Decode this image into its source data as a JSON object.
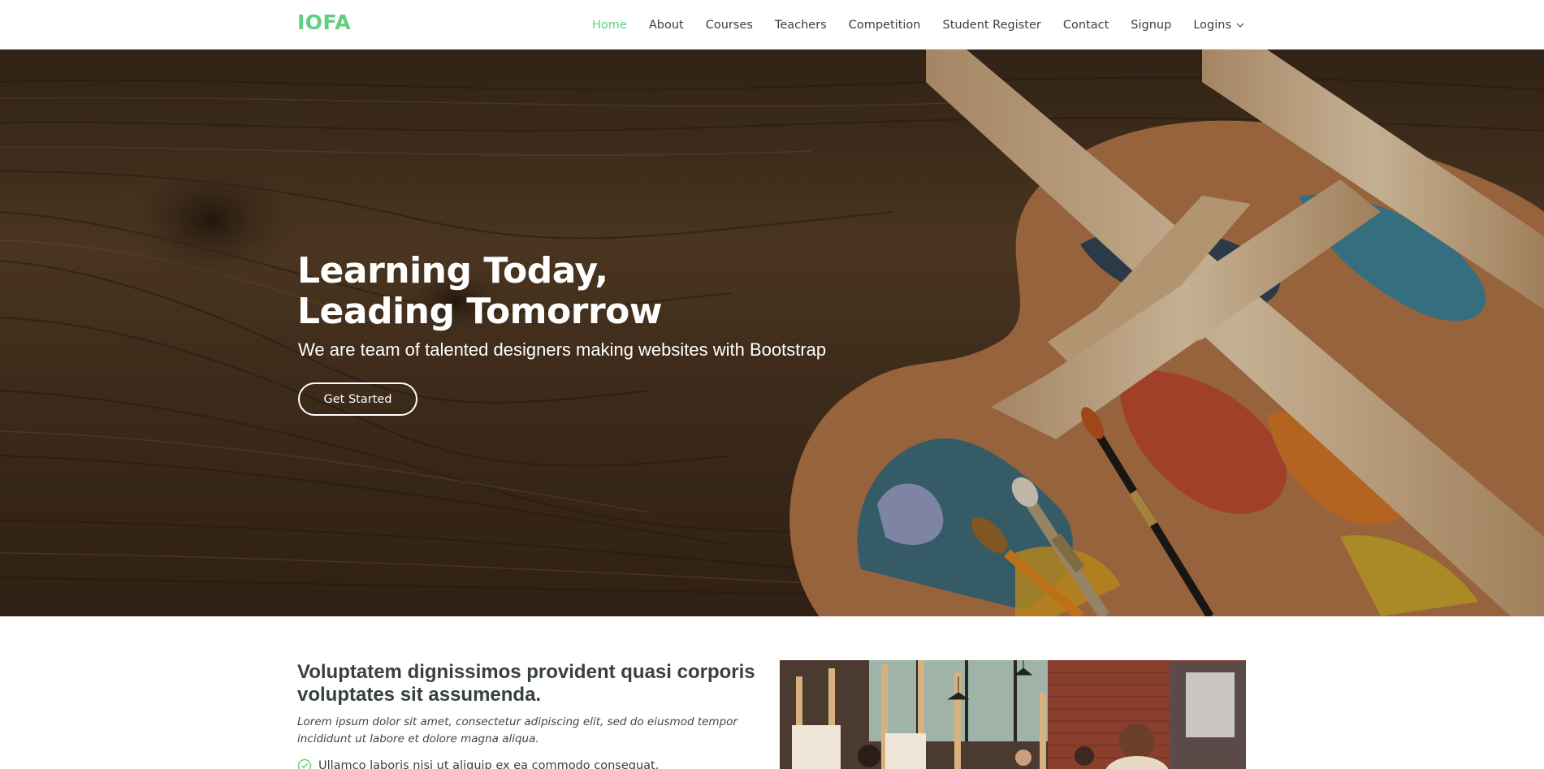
{
  "brand": {
    "logo": "IOFA",
    "accent": "#5fcf80"
  },
  "nav": {
    "items": [
      {
        "label": "Home",
        "active": true
      },
      {
        "label": "About",
        "active": false
      },
      {
        "label": "Courses",
        "active": false
      },
      {
        "label": "Teachers",
        "active": false
      },
      {
        "label": "Competition",
        "active": false
      },
      {
        "label": "Student Register",
        "active": false
      },
      {
        "label": "Contact",
        "active": false
      },
      {
        "label": "Signup",
        "active": false
      },
      {
        "label": "Logins",
        "active": false,
        "icon": "chevron-down-icon"
      }
    ]
  },
  "hero": {
    "title_line1": "Learning Today,",
    "title_line2": "Leading Tomorrow",
    "subtitle": "We are team of talented designers making websites with Bootstrap",
    "cta_label": "Get Started"
  },
  "about": {
    "title": "Voluptatem dignissimos provident quasi corporis voluptates sit assumenda.",
    "lead": "Lorem ipsum dolor sit amet, consectetur adipiscing elit, sed do eiusmod tempor incididunt ut labore et dolore magna aliqua.",
    "items": [
      {
        "text": "Ullamco laboris nisi ut aliquip ex ea commodo consequat.",
        "icon": "check-circle-icon"
      }
    ]
  }
}
